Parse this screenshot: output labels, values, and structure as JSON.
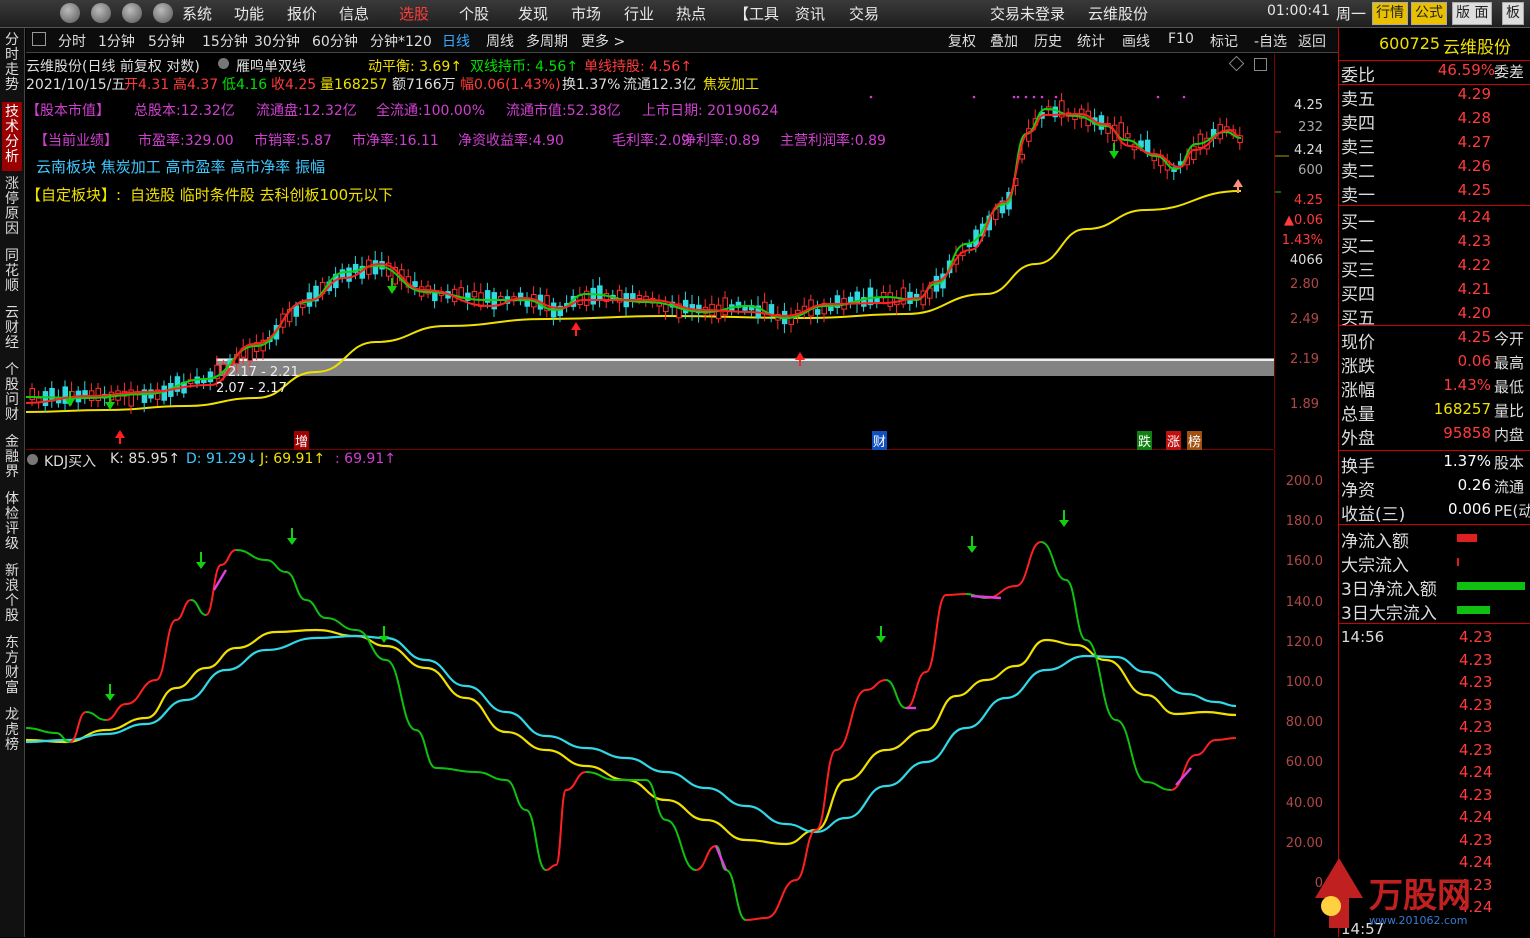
{
  "menu": {
    "items": [
      "系统",
      "功能",
      "报价",
      "信息",
      "选股",
      "个股",
      "发现",
      "市场",
      "行业",
      "热点",
      "【工具",
      "资讯",
      "交易"
    ],
    "active_index": 4,
    "login_status": "交易未登录",
    "stock_name": "云维股份",
    "time": "01:00:41",
    "weekday": "周一",
    "btns": [
      "行情",
      "公式",
      "版 面",
      "板"
    ]
  },
  "periods": {
    "items": [
      "分时",
      "1分钟",
      "5分钟",
      "15分钟",
      "30分钟",
      "60分钟",
      "分钟*120",
      "日线",
      "周线",
      "多周期",
      "更多 >"
    ],
    "active_index": 7,
    "tools": [
      "复权",
      "叠加",
      "历史",
      "统计",
      "画线",
      "F10",
      "标记",
      "-自选",
      "返回"
    ]
  },
  "left_tabs": [
    {
      "label": "分时走势",
      "active": false
    },
    {
      "label": "技术分析",
      "active": true
    },
    {
      "label": "涨停原因",
      "active": false
    },
    {
      "label": "同花顺",
      "active": false
    },
    {
      "label": "云财经",
      "active": false
    },
    {
      "label": "个股问财",
      "active": false
    },
    {
      "label": "金融界",
      "active": false
    },
    {
      "label": "体检评级",
      "active": false
    },
    {
      "label": "新浪个股",
      "active": false
    },
    {
      "label": "东方财富",
      "active": false
    },
    {
      "label": "龙虎榜",
      "active": false
    }
  ],
  "chart_header": {
    "title": "云维股份(日线 前复权 对数)",
    "indicator": "雁鸣单双线",
    "dongpingheng": "动平衡: 3.69↑",
    "shuangxian": "双线持币: 4.56↑",
    "danxian": "单线持股: 4.56↑",
    "date": "2021/10/15/五",
    "open": "开4.31",
    "high": "高4.37",
    "low": "低4.16",
    "close": "收4.25",
    "volume": "量168257",
    "amount": "额7166万",
    "change": "幅0.06(1.43%)",
    "turnover": "换1.37%",
    "float": "流通12.3亿",
    "concept": "焦炭加工"
  },
  "fundamentals": {
    "line1": [
      "【股本市值】",
      "总股本:12.32亿",
      "流通盘:12.32亿",
      "全流通:100.00%",
      "流通市值:52.38亿",
      "上市日期: 20190624"
    ],
    "line2": [
      "【当前业绩】",
      "市盈率:329.00",
      "市销率:5.87",
      "市净率:16.11",
      "净资收益率:4.90",
      "毛利率:2.09",
      "净利率:0.89",
      "主营利润率:0.89"
    ],
    "line3": "云南板块 焦炭加工 高市盈率 高市净率 振幅",
    "line4_label": "【自定板块】:",
    "line4": "自选股 临时条件股 去科创板100元以下"
  },
  "price_box": {
    "label1": "2.17 - 2.21",
    "label2": "2.07 - 2.17"
  },
  "price_markers": {
    "zeng": "增",
    "cai": "财",
    "die": "跌",
    "zhang": "涨",
    "bang": "榜"
  },
  "price_axis": [
    "4.25",
    "232",
    "4.24",
    "600",
    "4.25",
    "▲0.06",
    "1.43%",
    "4066",
    "2.80",
    "2.49",
    "2.19",
    "1.89"
  ],
  "kdj_header": {
    "name": "KDJ买入",
    "k": "K: 85.95↑",
    "d": "D: 91.29↓",
    "j": "J: 69.91↑",
    "x": ": 69.91↑"
  },
  "kdj_axis": [
    "200.0",
    "180.0",
    "160.0",
    "140.0",
    "120.0",
    "100.0",
    "80.00",
    "60.00",
    "40.00",
    "20.00",
    "0"
  ],
  "chart_data": [
    {
      "type": "line",
      "title": "云维股份(日线 前复权 对数)",
      "x": [
        "2021/10/15"
      ],
      "series": [
        {
          "name": "收",
          "values": [
            4.25
          ]
        }
      ],
      "ylim": [
        1.89,
        4.25
      ]
    },
    {
      "type": "line",
      "title": "KDJ买入",
      "x": [
        "2021/10/15"
      ],
      "series": [
        {
          "name": "K",
          "values": [
            85.95
          ]
        },
        {
          "name": "D",
          "values": [
            91.29
          ]
        },
        {
          "name": "J",
          "values": [
            69.91
          ]
        }
      ],
      "ylim": [
        0,
        200
      ]
    }
  ],
  "right": {
    "code": "600725",
    "name": "云维股份",
    "weibi_label": "委比",
    "weibi": "46.59%",
    "weibi_extra": "委差",
    "asks": [
      {
        "label": "卖五",
        "price": "4.29"
      },
      {
        "label": "卖四",
        "price": "4.28"
      },
      {
        "label": "卖三",
        "price": "4.27"
      },
      {
        "label": "卖二",
        "price": "4.26"
      },
      {
        "label": "卖一",
        "price": "4.25"
      }
    ],
    "bids": [
      {
        "label": "买一",
        "price": "4.24"
      },
      {
        "label": "买二",
        "price": "4.23"
      },
      {
        "label": "买三",
        "price": "4.22"
      },
      {
        "label": "买四",
        "price": "4.21"
      },
      {
        "label": "买五",
        "price": "4.20"
      }
    ],
    "quote": [
      {
        "label": "现价",
        "value": "4.25",
        "extra": "今开",
        "color": "#ff3b3b"
      },
      {
        "label": "涨跌",
        "value": "0.06",
        "extra": "最高",
        "color": "#ff3b3b"
      },
      {
        "label": "涨幅",
        "value": "1.43%",
        "extra": "最低",
        "color": "#ff3b3b"
      },
      {
        "label": "总量",
        "value": "168257",
        "extra": "量比",
        "color": "#f0e000"
      },
      {
        "label": "外盘",
        "value": "95858",
        "extra": "内盘",
        "color": "#ff3b3b"
      }
    ],
    "quote2": [
      {
        "label": "换手",
        "value": "1.37%",
        "extra": "股本"
      },
      {
        "label": "净资",
        "value": "0.26",
        "extra": "流通"
      },
      {
        "label": "收益(三)",
        "value": "0.006",
        "extra": "PE(动"
      }
    ],
    "flows": [
      {
        "label": "净流入额",
        "bar_color": "#e02020",
        "bar": 0.18
      },
      {
        "label": "大宗流入",
        "bar_color": "#e02020",
        "bar": 0.02
      },
      {
        "label": "3日净流入额",
        "bar_color": "#10c010",
        "bar": 0.62
      },
      {
        "label": "3日大宗流入",
        "bar_color": "#10c010",
        "bar": 0.3
      }
    ],
    "ticks_time": "14:56",
    "ticks": [
      "4.23",
      "4.23",
      "4.23",
      "4.23",
      "4.23",
      "4.23",
      "4.24",
      "4.23",
      "4.24",
      "4.23",
      "4.24",
      "4.23",
      "4.24"
    ],
    "ticks_time2": "14:57",
    "watermark": "万股网",
    "watermark_url": "www.201062.com"
  }
}
